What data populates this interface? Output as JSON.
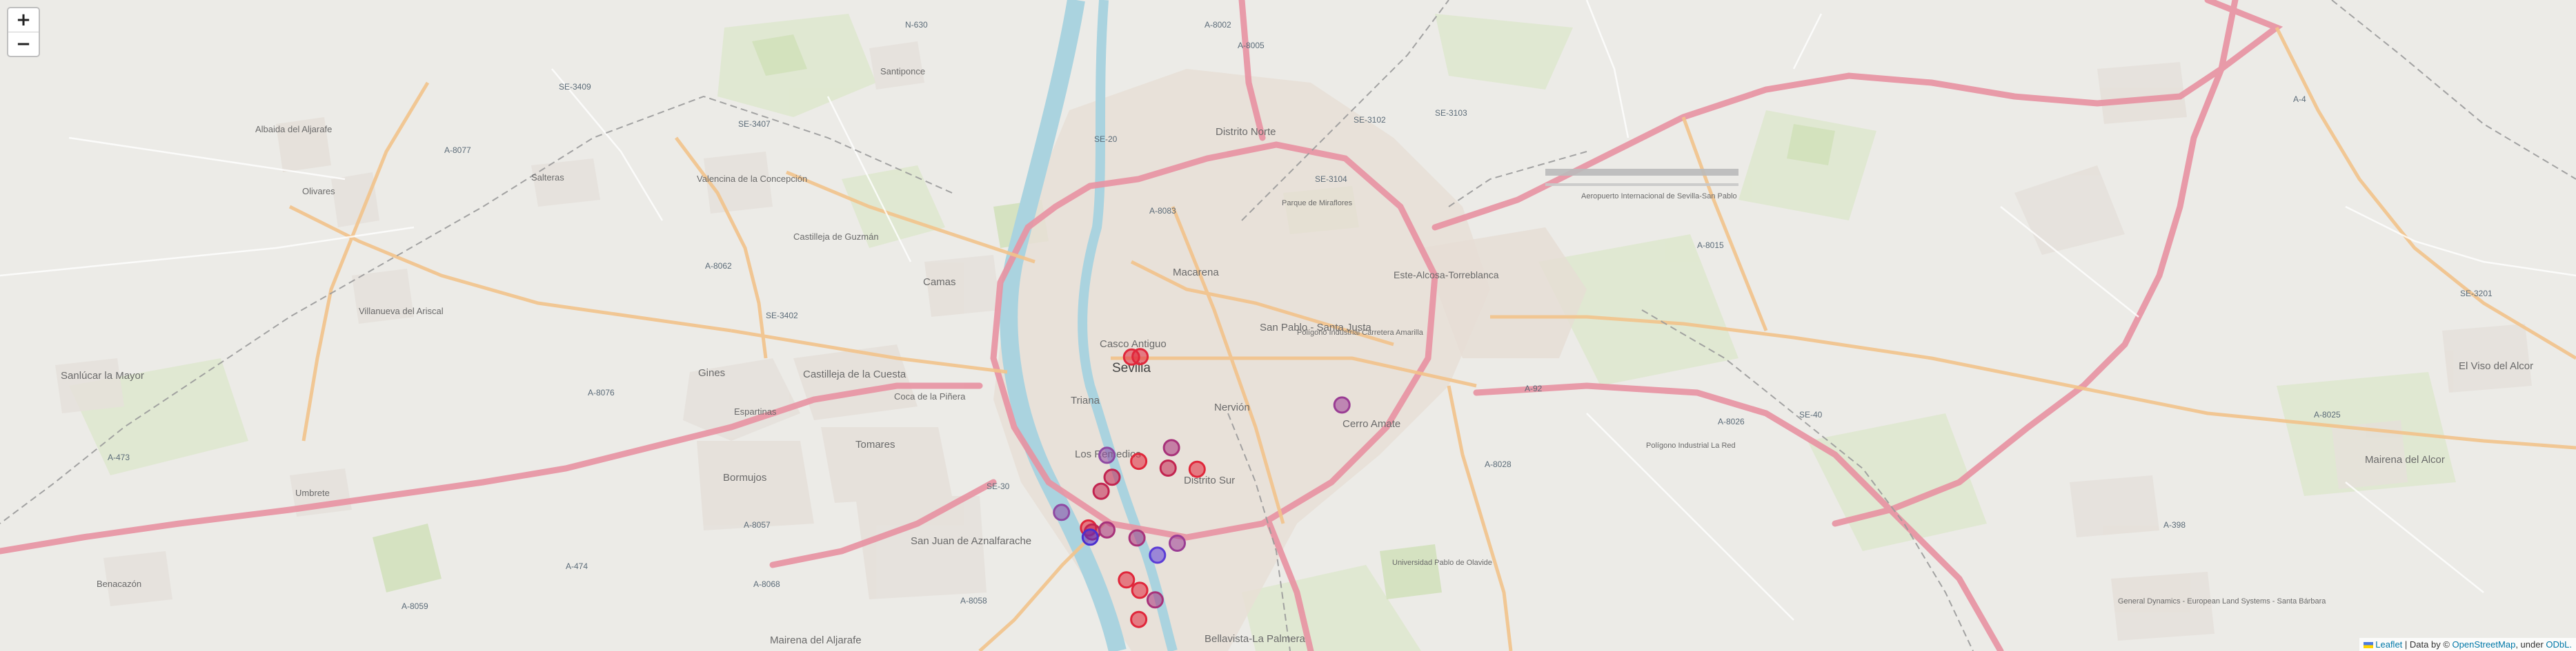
{
  "map": {
    "zoom_in_label": "+",
    "zoom_out_label": "−",
    "places": {
      "distrito_norte": "Distrito Norte",
      "macarena": "Macarena",
      "casco_antiguo": "Casco Antiguo",
      "sevilla": "Sevilla",
      "triana": "Triana",
      "los_remedios": "Los Remedios",
      "distrito_sur": "Distrito Sur",
      "nervion": "Nervión",
      "cerro_amate": "Cerro Amate",
      "san_pablo_santa_justa": "San Pablo - Santa Justa",
      "este_alcosa": "Este-Alcosa-Torreblanca",
      "bellavista": "Bellavista-La Palmera",
      "camas": "Camas",
      "tomares": "Tomares",
      "bormujos": "Bormujos",
      "gines": "Gines",
      "espartinas": "Espartinas",
      "castilleja_cuesta": "Castilleja de la Cuesta",
      "coca_pinera": "Coca de la Piñera",
      "castilleja_guzman": "Castilleja de Guzmán",
      "valencina": "Valencina de la Concepción",
      "salteras": "Salteras",
      "olivares": "Olivares",
      "albaida": "Albaida del Aljarafe",
      "villanueva": "Villanueva del Ariscal",
      "sanlucar": "Sanlúcar la Mayor",
      "umbrete": "Umbrete",
      "benacazon": "Benacazón",
      "san_juan": "San Juan de Aznalfarache",
      "mairena_aljarafe": "Mairena del Aljarafe",
      "santiponce": "Santiponce",
      "el_viso": "El Viso del Alcor",
      "mairena_alcor": "Mairena del Alcor",
      "aeropuerto": "Aeropuerto Internacional de Sevilla-San Pablo",
      "parque_miraflores": "Parque de Miraflores",
      "poligono_red": "Polígono Industrial La Red",
      "poligono_carretera": "Polígono Industrial Carretera Amarilla",
      "universidad": "Universidad Pablo de Olavide",
      "general_dynamics": "General Dynamics - European Land Systems - Santa Bárbara"
    },
    "roads": [
      "N-630",
      "A-8002",
      "A-8005",
      "SE-3102",
      "SE-3103",
      "SE-20",
      "A-8083",
      "SE-3104",
      "A-8077",
      "SE-3409",
      "SE-3407",
      "A-8062",
      "SE-3402",
      "A-8076",
      "A-473",
      "A-4",
      "A-8015",
      "SE-3201",
      "A-92",
      "A-8028",
      "A-8026",
      "A-8025",
      "SE-40",
      "A-474",
      "A-8059",
      "A-8058",
      "A-8068",
      "A-8057",
      "SE-30",
      "A-398"
    ]
  },
  "markers": [
    {
      "id": "m1",
      "lat": 37.4146,
      "lng": -5.9788,
      "color": "#e0273b"
    },
    {
      "id": "m2",
      "lat": 37.4147,
      "lng": -5.9763,
      "color": "#e0273b"
    },
    {
      "id": "m3",
      "lat": 37.4026,
      "lng": -5.9172,
      "color": "#9a3d94"
    },
    {
      "id": "m4",
      "lat": 37.3919,
      "lng": -5.9671,
      "color": "#a8327a"
    },
    {
      "id": "m5",
      "lat": 37.39,
      "lng": -5.986,
      "color": "#8f4aa3"
    },
    {
      "id": "m6",
      "lat": 37.3885,
      "lng": -5.9767,
      "color": "#e0273b"
    },
    {
      "id": "m7",
      "lat": 37.3868,
      "lng": -5.9681,
      "color": "#c22450"
    },
    {
      "id": "m8",
      "lat": 37.3865,
      "lng": -5.9596,
      "color": "#e0273b"
    },
    {
      "id": "m9",
      "lat": 37.3845,
      "lng": -5.9845,
      "color": "#c22450"
    },
    {
      "id": "m10",
      "lat": 37.381,
      "lng": -5.9877,
      "color": "#c22450"
    },
    {
      "id": "m11",
      "lat": 37.3757,
      "lng": -5.9993,
      "color": "#8f4aa3"
    },
    {
      "id": "m12",
      "lat": 37.3718,
      "lng": -5.9914,
      "color": "#e0273b"
    },
    {
      "id": "m13",
      "lat": 37.3708,
      "lng": -5.9903,
      "color": "#c22450"
    },
    {
      "id": "m14",
      "lat": 37.3713,
      "lng": -5.986,
      "color": "#a8327a"
    },
    {
      "id": "m15",
      "lat": 37.3695,
      "lng": -5.9909,
      "color": "#4b2fcf"
    },
    {
      "id": "m16",
      "lat": 37.3693,
      "lng": -5.9772,
      "color": "#a8327a"
    },
    {
      "id": "m17",
      "lat": 37.368,
      "lng": -5.9654,
      "color": "#9a3d94"
    },
    {
      "id": "m18",
      "lat": 37.365,
      "lng": -5.9712,
      "color": "#5b3cd6"
    },
    {
      "id": "m19",
      "lat": 37.3588,
      "lng": -5.9803,
      "color": "#e0273b"
    },
    {
      "id": "m20",
      "lat": 37.3562,
      "lng": -5.9764,
      "color": "#e0273b"
    },
    {
      "id": "m21",
      "lat": 37.3538,
      "lng": -5.9719,
      "color": "#a8327a"
    },
    {
      "id": "m22",
      "lat": 37.3489,
      "lng": -5.9767,
      "color": "#e0273b"
    }
  ],
  "attribution": {
    "leaflet": "Leaflet",
    "data_by": "| Data by ©",
    "osm": "OpenStreetMap",
    "under": ", under",
    "odbl": "ODbL."
  }
}
